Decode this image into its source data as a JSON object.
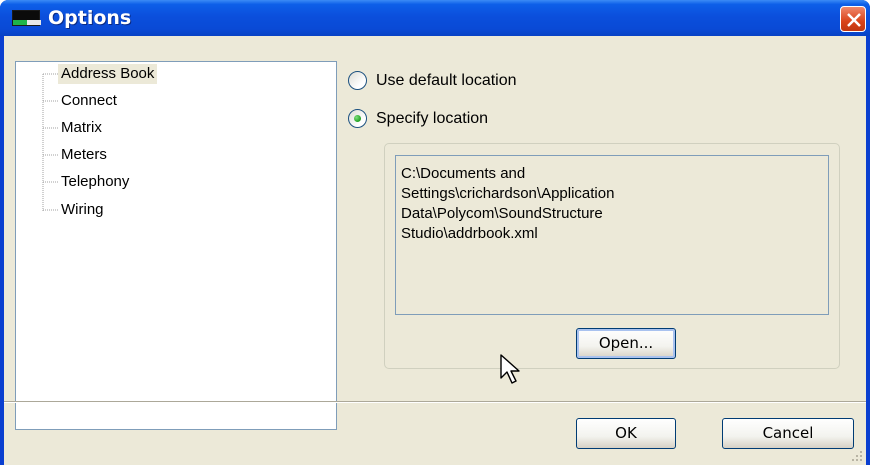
{
  "window": {
    "title": "Options",
    "icon": "app-icon",
    "close_icon": "close-icon"
  },
  "tree": {
    "items": [
      {
        "label": "Address Book",
        "selected": true
      },
      {
        "label": "Connect",
        "selected": false
      },
      {
        "label": "Matrix",
        "selected": false
      },
      {
        "label": "Meters",
        "selected": false
      },
      {
        "label": "Telephony",
        "selected": false
      },
      {
        "label": "Wiring",
        "selected": false
      }
    ]
  },
  "location": {
    "use_default_label": "Use default location",
    "use_default_checked": false,
    "specify_label": "Specify location",
    "specify_checked": true,
    "path": "C:\\Documents and\nSettings\\crichardson\\Application\nData\\Polycom\\SoundStructure\nStudio\\addrbook.xml",
    "open_label": "Open..."
  },
  "footer": {
    "ok_label": "OK",
    "cancel_label": "Cancel"
  },
  "colors": {
    "titlebar": "#0a4ad6",
    "dialog_bg": "#ece9d8",
    "close_red": "#d9441a",
    "radio_dot": "#21a121"
  }
}
